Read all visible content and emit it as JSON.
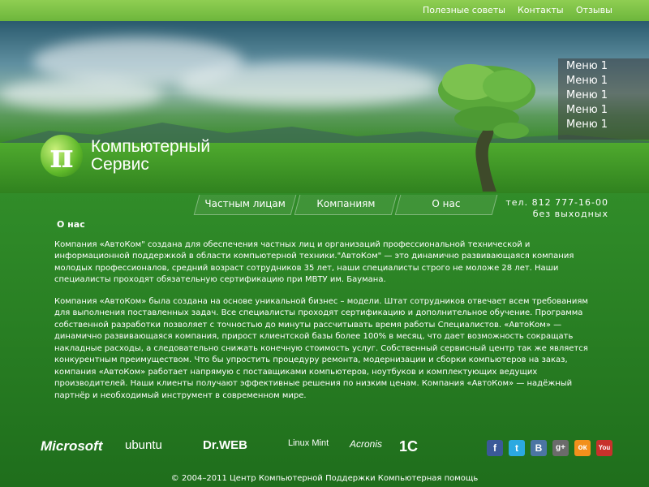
{
  "topnav": {
    "items": [
      "Полезные советы",
      "Контакты",
      "Отзывы"
    ]
  },
  "logo": {
    "symbol": "π",
    "line1": "Компьютерный",
    "line2": "Сервис"
  },
  "sidemenu": {
    "items": [
      "Меню 1",
      "Меню 1",
      "Меню 1",
      "Меню 1",
      "Меню 1"
    ]
  },
  "tabs": {
    "items": [
      "Частным лицам",
      "Компаниям",
      "О нас"
    ]
  },
  "contact": {
    "phone": "тел. 812 777-16-00",
    "hours": "без выходных"
  },
  "content": {
    "title": "О нас",
    "paragraph1": "Компания «АвтоКом\" создана для обеспечения частных лиц и организаций профессиональной технической и информационной поддержкой в области компьютерной техники.\"АвтоКом\" — это динамично развивающаяся компания молодых профессионалов, средний возраст сотрудников 35 лет, наши специалисты строго не моложе 28 лет. Наши специалисты проходят обязательную сертификацию при МВТУ им. Баумана.",
    "paragraph2": "Компания «АвтоКом» была создана на основе уникальной бизнес – модели. Штат сотрудников отвечает всем требованиям для выполнения поставленных задач. Все специалисты проходят сертификацию и дополнительное обучение. Программа собственной разработки позволяет с точностью до минуты рассчитывать время работы Специалистов. «АвтоКом» — динамично развивающаяся компания, прирост клиентской базы более 100% в месяц, что дает возможность сокращать накладные расходы, а следовательно снижать конечную стоимость услуг. Собственный сервисный центр так же является конкурентным преимуществом. Что бы упростить процедуру ремонта, модернизации и сборки компьютеров на заказ, компания «АвтоКом» работает напрямую с поставщиками компьютеров, ноутбуков и комплектующих ведущих производителей. Наши клиенты получают эффективные решения по низким ценам. Компания «АвтоКом» — надёжный партнёр и необходимый инструмент в современном мире."
  },
  "partners": [
    "Microsoft",
    "ubuntu",
    "Dr.WEB",
    "Linux Mint",
    "Acronis",
    "1С"
  ],
  "socials": [
    {
      "icon": "facebook-icon",
      "glyph": "f",
      "color": "#3b5998"
    },
    {
      "icon": "twitter-icon",
      "glyph": "t",
      "color": "#2ba9e1"
    },
    {
      "icon": "vkontakte-icon",
      "glyph": "В",
      "color": "#4c75a3"
    },
    {
      "icon": "google-plus-icon",
      "glyph": "g+",
      "color": "#6b6b6b"
    },
    {
      "icon": "odnoklassniki-icon",
      "glyph": "ок",
      "color": "#f2901c"
    },
    {
      "icon": "youtube-icon",
      "glyph": "You",
      "color": "#c8312b"
    }
  ],
  "footer": {
    "text": "© 2004–2011 Центр Компьютерной Поддержки Компьютерная помощь"
  }
}
